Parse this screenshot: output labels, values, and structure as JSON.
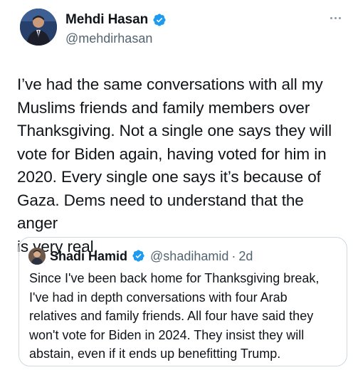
{
  "tweet": {
    "author": {
      "display_name": "Mehdi Hasan",
      "handle": "@mehdirhasan",
      "avatar_icon": "profile-photo",
      "verified_icon": "verified-badge-icon"
    },
    "more_icon": "more-options-icon",
    "text": "I’ve had the same conversations with all my\nMuslims friends and family members over\nThanksgiving. Not a single one says they will\nvote for Biden again, having voted for him in\n2020. Every single one says it’s because of\nGaza. Dems need to understand that the anger\nis very real."
  },
  "quote": {
    "author": {
      "display_name": "Shadi Hamid",
      "handle": "@shadihamid",
      "separator": "·",
      "date": "2d",
      "verified_icon": "verified-badge-icon"
    },
    "text": "Since I've been back home for Thanksgiving break,\nI've  had in depth conversations with four Arab\nrelatives and family friends. All four have said they\nwon't vote for Biden in 2024. They insist they will\nabstain, even if it ends up benefitting Trump."
  },
  "colors": {
    "text": "#0f1419",
    "secondary": "#536471",
    "verified": "#1d9bf0",
    "border": "#cfd9de"
  }
}
